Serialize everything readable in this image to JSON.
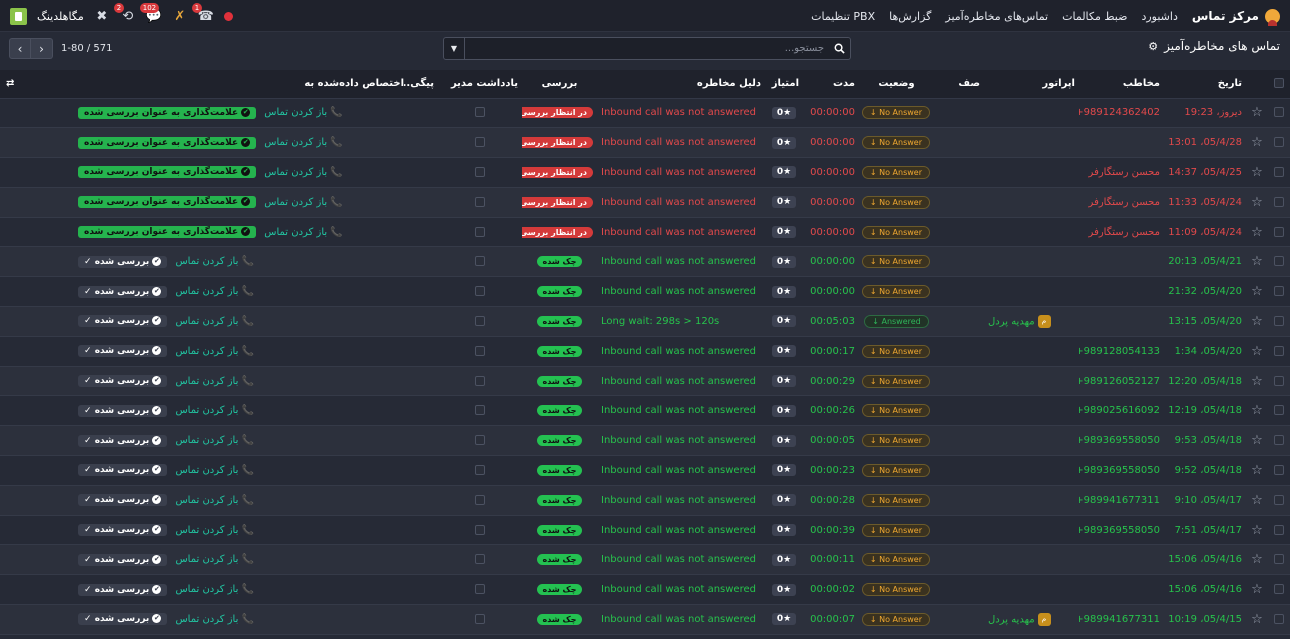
{
  "topnav": {
    "brand": "مرکز تماس",
    "items": [
      "داشبورد",
      "ضبط مکالمات",
      "تماس‌های مخاطره‌آمیز",
      "گزارش‌ها",
      "تنظیمات PBX"
    ],
    "company": "مگاهلدینگ",
    "badges": {
      "activity": "2",
      "messages": "102",
      "calls": "1"
    }
  },
  "controlbar": {
    "title": "تماس های مخاطره‌آمیز",
    "search_placeholder": "جستجو...",
    "pager": "1-80 / 571"
  },
  "columns": {
    "date": "تاریخ",
    "contact": "مخاطب",
    "operator": "اپراتور",
    "queue": "صف",
    "status": "وضعیت",
    "duration": "مدت",
    "score": "امتیاز",
    "reason": "دلیل مخاطره",
    "review": "بررسی",
    "note": "یادداشت مدیر",
    "followup": "پیگی...",
    "assigned": "اختصاص داده‌شده به"
  },
  "labels": {
    "open_call": "باز کردن تماس",
    "mark_reviewed": "علامت‌گذاری به عنوان بررسی شده",
    "reviewed": "بررسی شده",
    "pending": "در انتظار بررسی",
    "checked": "چک شده",
    "score_val": "0"
  },
  "rows": [
    {
      "date": "دیروز، 19:23",
      "contact": "+989124362402",
      "operator": "",
      "status": "No Answer",
      "duration": "00:00:00",
      "reason": "Inbound call was not answered",
      "review": "pending",
      "tone": "red"
    },
    {
      "date": "05/4/28، 13:01",
      "contact": "",
      "operator": "",
      "status": "No Answer",
      "duration": "00:00:00",
      "reason": "Inbound call was not answered",
      "review": "pending",
      "tone": "red"
    },
    {
      "date": "05/4/25، 14:37",
      "contact": "محسن رستگارفر",
      "operator": "",
      "status": "No Answer",
      "duration": "00:00:00",
      "reason": "Inbound call was not answered",
      "review": "pending",
      "tone": "red"
    },
    {
      "date": "05/4/24، 11:33",
      "contact": "محسن رستگارفر",
      "operator": "",
      "status": "No Answer",
      "duration": "00:00:00",
      "reason": "Inbound call was not answered",
      "review": "pending",
      "tone": "red"
    },
    {
      "date": "05/4/24، 11:09",
      "contact": "محسن رستگارفر",
      "operator": "",
      "status": "No Answer",
      "duration": "00:00:00",
      "reason": "Inbound call was not answered",
      "review": "pending",
      "tone": "red"
    },
    {
      "date": "05/4/21، 20:13",
      "contact": "",
      "operator": "",
      "status": "No Answer",
      "duration": "00:00:00",
      "reason": "Inbound call was not answered",
      "review": "checked",
      "tone": "green"
    },
    {
      "date": "05/4/20، 21:32",
      "contact": "",
      "operator": "",
      "status": "No Answer",
      "duration": "00:00:00",
      "reason": "Inbound call was not answered",
      "review": "checked",
      "tone": "green"
    },
    {
      "date": "05/4/20، 13:15",
      "contact": "",
      "operator": "مهدیه پردل",
      "status": "Answered",
      "duration": "00:05:03",
      "reason": "Long wait: 298s > 120s",
      "review": "checked",
      "tone": "green"
    },
    {
      "date": "05/4/20، 1:34",
      "contact": "+989128054133",
      "operator": "",
      "status": "No Answer",
      "duration": "00:00:17",
      "reason": "Inbound call was not answered",
      "review": "checked",
      "tone": "green"
    },
    {
      "date": "05/4/18، 12:20",
      "contact": "+989126052127",
      "operator": "",
      "status": "No Answer",
      "duration": "00:00:29",
      "reason": "Inbound call was not answered",
      "review": "checked",
      "tone": "green"
    },
    {
      "date": "05/4/18، 12:19",
      "contact": "+989025616092",
      "operator": "",
      "status": "No Answer",
      "duration": "00:00:26",
      "reason": "Inbound call was not answered",
      "review": "checked",
      "tone": "green"
    },
    {
      "date": "05/4/18، 9:53",
      "contact": "+989369558050",
      "operator": "",
      "status": "No Answer",
      "duration": "00:00:05",
      "reason": "Inbound call was not answered",
      "review": "checked",
      "tone": "green"
    },
    {
      "date": "05/4/18، 9:52",
      "contact": "+989369558050",
      "operator": "",
      "status": "No Answer",
      "duration": "00:00:23",
      "reason": "Inbound call was not answered",
      "review": "checked",
      "tone": "green"
    },
    {
      "date": "05/4/17، 9:10",
      "contact": "+989941677311",
      "operator": "",
      "status": "No Answer",
      "duration": "00:00:28",
      "reason": "Inbound call was not answered",
      "review": "checked",
      "tone": "green"
    },
    {
      "date": "05/4/17، 7:51",
      "contact": "+989369558050",
      "operator": "",
      "status": "No Answer",
      "duration": "00:00:39",
      "reason": "Inbound call was not answered",
      "review": "checked",
      "tone": "green"
    },
    {
      "date": "05/4/16، 15:06",
      "contact": "",
      "operator": "",
      "status": "No Answer",
      "duration": "00:00:11",
      "reason": "Inbound call was not answered",
      "review": "checked",
      "tone": "green"
    },
    {
      "date": "05/4/16، 15:06",
      "contact": "",
      "operator": "",
      "status": "No Answer",
      "duration": "00:00:02",
      "reason": "Inbound call was not answered",
      "review": "checked",
      "tone": "green"
    },
    {
      "date": "05/4/15، 10:19",
      "contact": "+989941677311",
      "operator": "مهدیه پردل",
      "status": "No Answer",
      "duration": "00:00:07",
      "reason": "Inbound call was not answered",
      "review": "checked",
      "tone": "green"
    }
  ]
}
